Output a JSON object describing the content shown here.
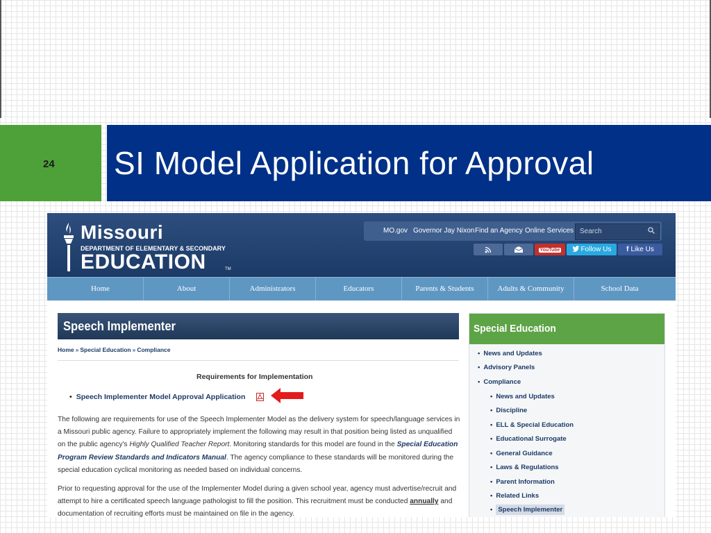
{
  "slide": {
    "number": "24",
    "title": "SI Model Application for Approval"
  },
  "site": {
    "logo": {
      "name": "Missouri",
      "department": "DEPARTMENT OF ELEMENTARY & SECONDARY",
      "word": "EDUCATION",
      "tm": "TM"
    },
    "top_links": [
      "MO.gov",
      "Governor Jay Nixon",
      "Find an Agency",
      "Online Services"
    ],
    "search": {
      "placeholder": "Search"
    },
    "social": {
      "youtube": "YouTube",
      "twitter": "Follow Us",
      "facebook": "Like Us"
    },
    "nav": [
      "Home",
      "About",
      "Administrators",
      "Educators",
      "Parents & Students",
      "Adults & Community",
      "School Data"
    ]
  },
  "page": {
    "heading": "Speech Implementer",
    "breadcrumb": [
      "Home",
      "Special Education",
      "Compliance"
    ],
    "requirements_heading": "Requirements for Implementation",
    "application_link": "Speech Implementer Model Approval Application",
    "para1": {
      "text1": "The following are requirements for use of the Speech Implementer Model as the delivery system for speech/language services in a Missouri public agency. Failure to appropriately implement the following may result in that position being listed as unqualified on the public agency's ",
      "em": "Highly Qualified Teacher Report.",
      "text2": "  Monitoring standards for this model are found in the ",
      "link": "Special Education Program Review Standards and Indicators Manual",
      "text3": ".  The agency compliance to these standards will be monitored during the special education cyclical monitoring as needed based on individual concerns."
    },
    "para2": {
      "text1": "Prior to requesting approval for the use of the Implementer Model during a given school year, agency must advertise/recruit and attempt to hire a certificated speech language pathologist to fill the position. This recruitment must be conducted ",
      "bold": "annually",
      "text2": " and documentation of recruiting efforts must be maintained on file in the agency."
    }
  },
  "sidebar": {
    "heading": "Special Education",
    "items": [
      {
        "label": "News and Updates",
        "level": 1
      },
      {
        "label": "Advisory Panels",
        "level": 1
      },
      {
        "label": "Compliance",
        "level": 1
      },
      {
        "label": "News and Updates",
        "level": 2
      },
      {
        "label": "Discipline",
        "level": 2
      },
      {
        "label": "ELL & Special Education",
        "level": 2
      },
      {
        "label": "Educational Surrogate",
        "level": 2
      },
      {
        "label": "General Guidance",
        "level": 2
      },
      {
        "label": "Laws & Regulations",
        "level": 2
      },
      {
        "label": "Parent Information",
        "level": 2
      },
      {
        "label": "Related Links",
        "level": 2
      },
      {
        "label": "Speech Implementer",
        "level": 2,
        "active": true
      }
    ]
  },
  "colors": {
    "title_band": "#003087",
    "number_box": "#4ea138",
    "site_header": "#1c3a66",
    "nav_bar": "#5f97c3",
    "sidebar_header": "#5da446",
    "arrow": "#e41b1b"
  }
}
